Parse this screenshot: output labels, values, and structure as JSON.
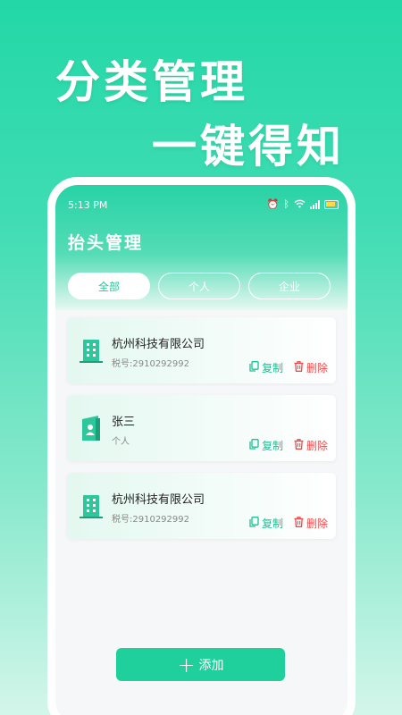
{
  "promo": {
    "line1": "分类管理",
    "line2": "一键得知"
  },
  "status_bar": {
    "time": "5:13 PM",
    "icons": [
      "alarm-icon",
      "bluetooth-icon",
      "wifi-icon",
      "signal-icon",
      "battery-icon"
    ]
  },
  "header": {
    "title": "抬头管理"
  },
  "tabs": [
    {
      "label": "全部",
      "active": true
    },
    {
      "label": "个人",
      "active": false
    },
    {
      "label": "企业",
      "active": false
    }
  ],
  "cards": [
    {
      "icon": "building-icon",
      "title": "杭州科技有限公司",
      "subtitle": "税号:2910292992",
      "copy_label": "复制",
      "delete_label": "删除"
    },
    {
      "icon": "person-id-icon",
      "title": "张三",
      "subtitle": "个人",
      "copy_label": "复制",
      "delete_label": "删除"
    },
    {
      "icon": "building-icon",
      "title": "杭州科技有限公司",
      "subtitle": "税号:2910292992",
      "copy_label": "复制",
      "delete_label": "删除"
    }
  ],
  "add_button": {
    "label": "添加"
  },
  "colors": {
    "accent": "#1fcf9c",
    "delete": "#f04a4a",
    "copy": "#1fbf94"
  }
}
